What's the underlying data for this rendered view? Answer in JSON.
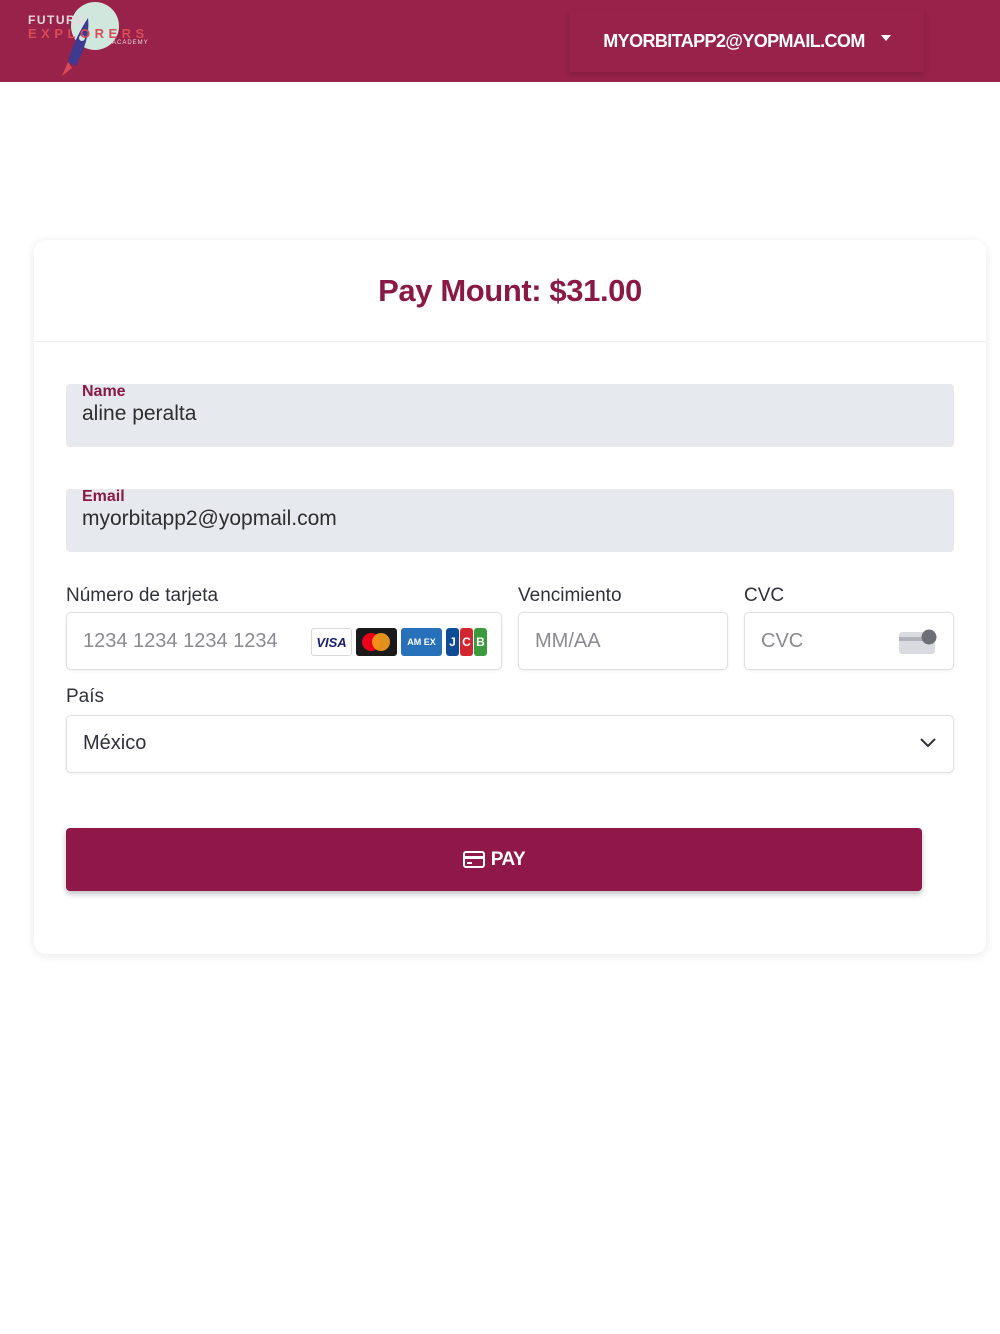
{
  "header": {
    "logo": {
      "line1": "FUTURE",
      "line2": "EXPLORERS",
      "line3": "ACADEMY"
    },
    "user_menu_label": "MYORBITAPP2@YOPMAIL.COM"
  },
  "payment": {
    "title": "Pay Mount: $31.00",
    "name": {
      "label": "Name",
      "value": "aline peralta"
    },
    "email": {
      "label": "Email",
      "value": "myorbitapp2@yopmail.com"
    },
    "card_number": {
      "label": "Número de tarjeta",
      "placeholder": "1234 1234 1234 1234"
    },
    "card_brands": [
      "visa",
      "mastercard",
      "amex",
      "jcb"
    ],
    "expiry": {
      "label": "Vencimiento",
      "placeholder": "MM/AA"
    },
    "cvc": {
      "label": "CVC",
      "placeholder": "CVC"
    },
    "country": {
      "label": "País",
      "value": "México"
    },
    "pay_button_label": "PAY"
  },
  "colors": {
    "brand": "#99224a",
    "button": "#8f1848",
    "field_bg": "#e6e9ed"
  }
}
